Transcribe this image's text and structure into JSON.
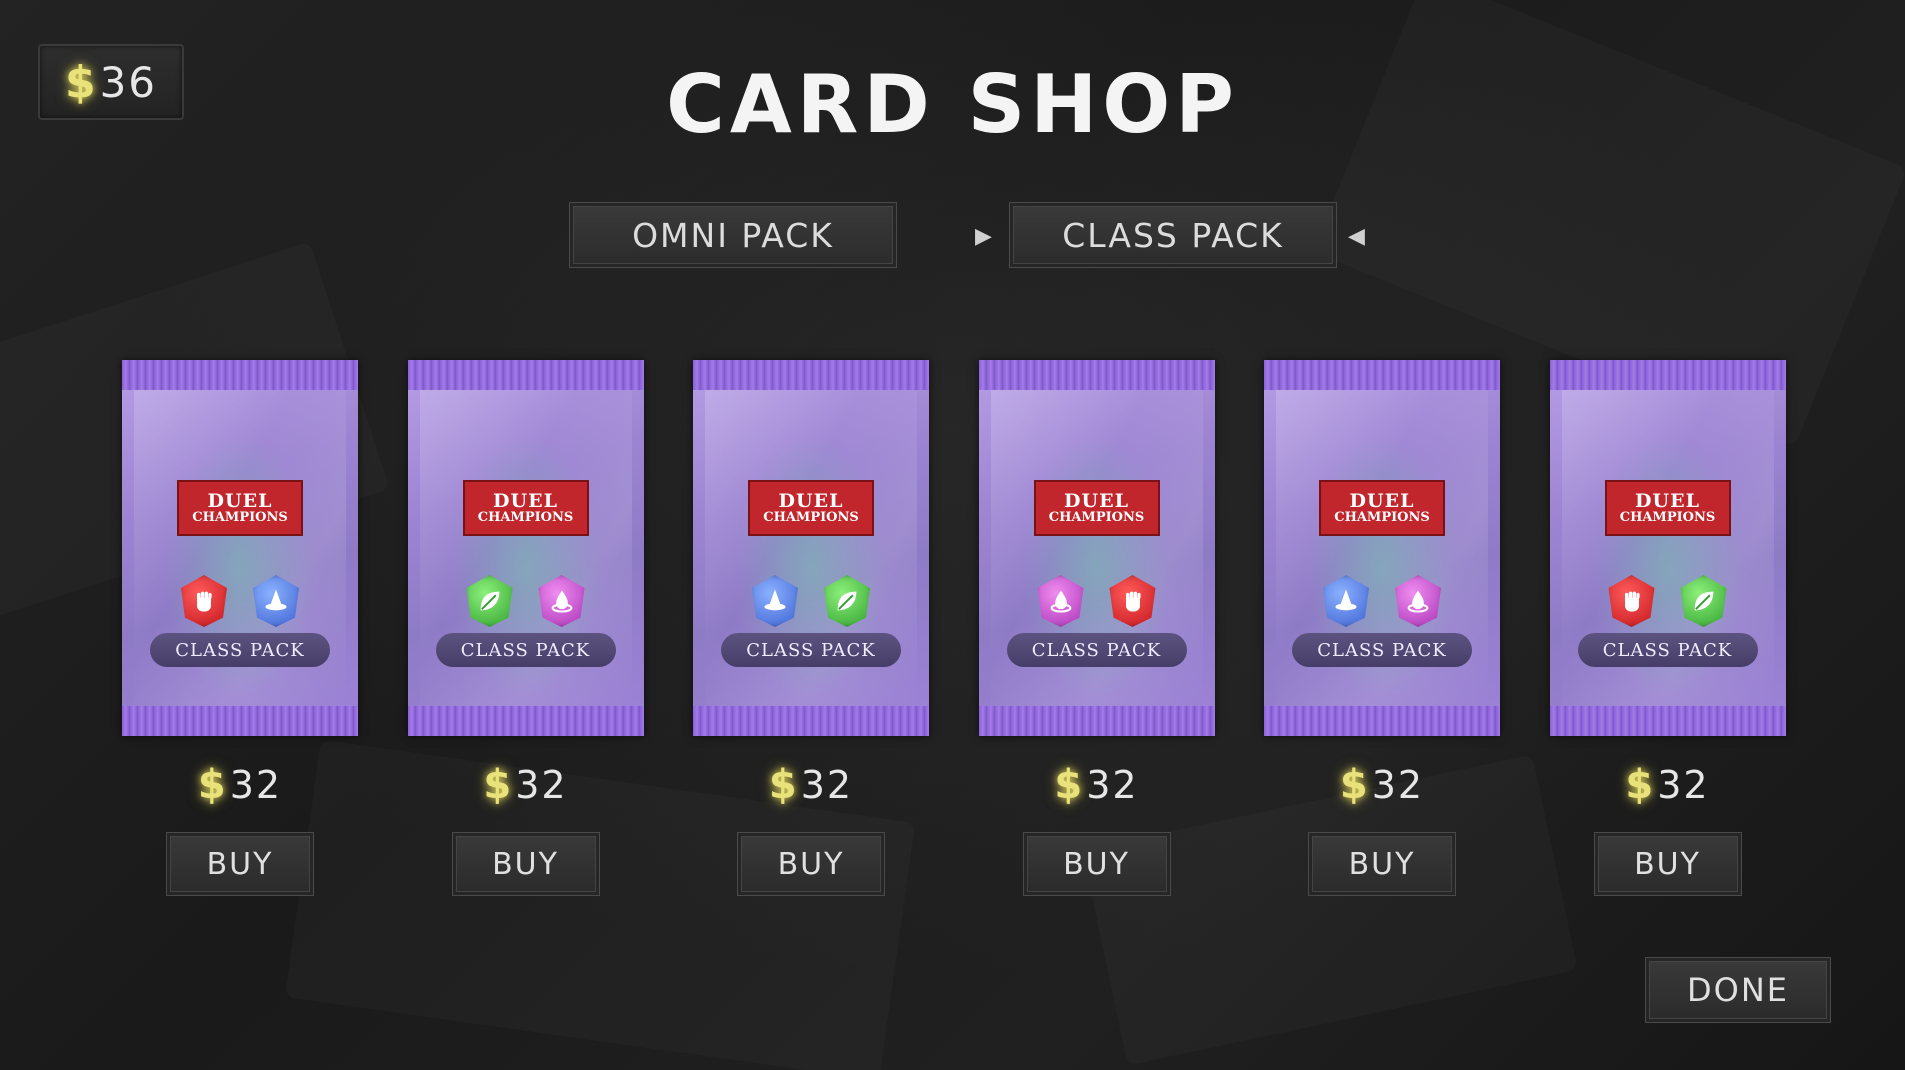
{
  "header": {
    "title": "CARD SHOP",
    "wallet": {
      "currency_symbol": "$",
      "amount": "36"
    }
  },
  "tabs": [
    {
      "label": "OMNI PACK",
      "selected": false
    },
    {
      "label": "CLASS PACK",
      "selected": true
    }
  ],
  "packs": [
    {
      "logo_line1": "DUEL",
      "logo_line2": "CHAMPIONS",
      "label": "CLASS PACK",
      "icons": [
        "fist-icon",
        "wizard-hat-icon"
      ],
      "currency_symbol": "$",
      "price": "32",
      "buy_label": "BUY"
    },
    {
      "logo_line1": "DUEL",
      "logo_line2": "CHAMPIONS",
      "label": "CLASS PACK",
      "icons": [
        "leaf-icon",
        "drop-icon"
      ],
      "currency_symbol": "$",
      "price": "32",
      "buy_label": "BUY"
    },
    {
      "logo_line1": "DUEL",
      "logo_line2": "CHAMPIONS",
      "label": "CLASS PACK",
      "icons": [
        "wizard-hat-icon",
        "leaf-icon"
      ],
      "currency_symbol": "$",
      "price": "32",
      "buy_label": "BUY"
    },
    {
      "logo_line1": "DUEL",
      "logo_line2": "CHAMPIONS",
      "label": "CLASS PACK",
      "icons": [
        "drop-icon",
        "fist-icon"
      ],
      "currency_symbol": "$",
      "price": "32",
      "buy_label": "BUY"
    },
    {
      "logo_line1": "DUEL",
      "logo_line2": "CHAMPIONS",
      "label": "CLASS PACK",
      "icons": [
        "wizard-hat-icon",
        "drop-icon"
      ],
      "currency_symbol": "$",
      "price": "32",
      "buy_label": "BUY"
    },
    {
      "logo_line1": "DUEL",
      "logo_line2": "CHAMPIONS",
      "label": "CLASS PACK",
      "icons": [
        "fist-icon",
        "leaf-icon"
      ],
      "currency_symbol": "$",
      "price": "32",
      "buy_label": "BUY"
    }
  ],
  "footer": {
    "done_label": "DONE"
  },
  "colors": {
    "coin_glow": "#e9e27a",
    "pack_purple": "#9c84d2",
    "fist_red": "#c0141a",
    "wizard_blue": "#3b5fcf",
    "leaf_green": "#2f9e2c",
    "drop_pink": "#a52fb3"
  }
}
